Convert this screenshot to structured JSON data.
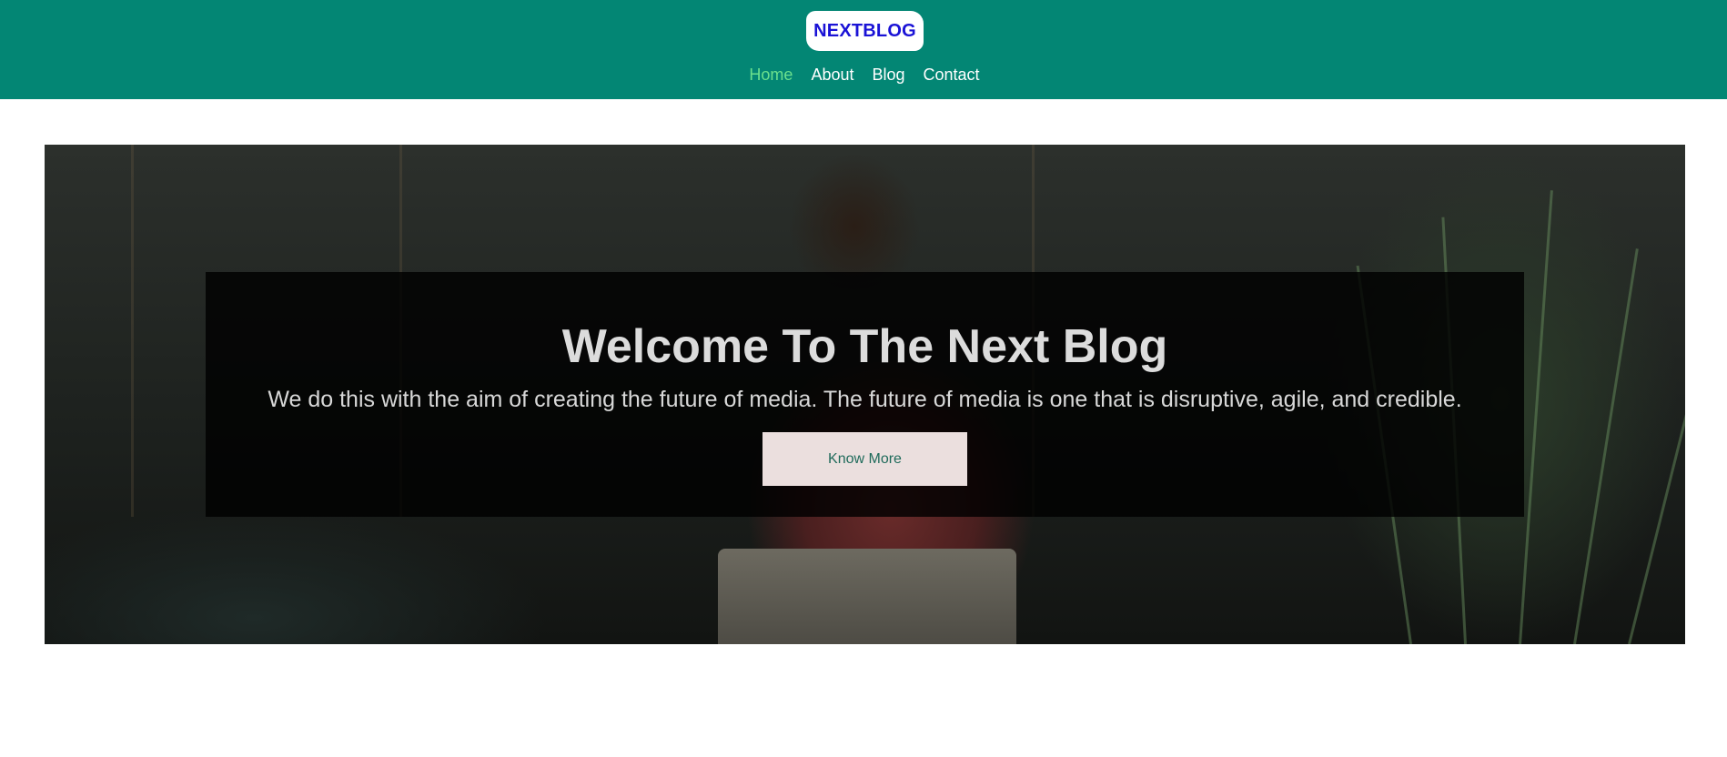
{
  "header": {
    "logo": "NEXTBLOG",
    "nav": [
      {
        "label": "Home",
        "active": true
      },
      {
        "label": "About",
        "active": false
      },
      {
        "label": "Blog",
        "active": false
      },
      {
        "label": "Contact",
        "active": false
      }
    ]
  },
  "hero": {
    "title": "Welcome To The Next Blog",
    "subtitle": "We do this with the aim of creating the future of media. The future of media is one that is disruptive, agile, and credible.",
    "cta_label": "Know More"
  },
  "colors": {
    "header_bg": "#038674",
    "logo_text": "#1a12d6",
    "nav_active": "#6be08d",
    "cta_bg": "#ebdfde",
    "cta_text": "#1f6b5b"
  }
}
